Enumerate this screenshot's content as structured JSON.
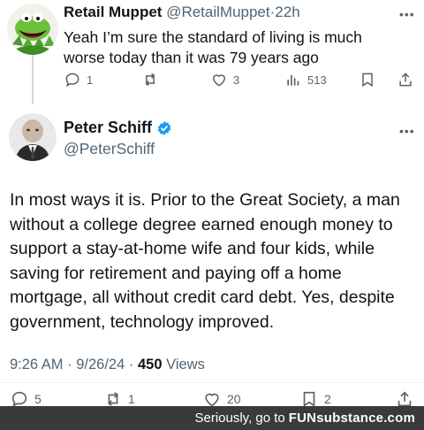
{
  "reply": {
    "name": "Retail Muppet",
    "handle": "@RetailMuppet",
    "separator": "·",
    "time": "22h",
    "text": "Yeah I’m sure the standard of living is much worse today than it was 79 years ago",
    "more": "•••",
    "actions": {
      "replies": "1",
      "retweets": "",
      "likes": "3",
      "views": "513"
    }
  },
  "tweet": {
    "name": "Peter Schiff",
    "handle": "@PeterSchiff",
    "more": "•••",
    "verified_color": "#1d9bf0",
    "text": "In most ways it is. Prior to the Great Society, a man without a college degree earned enough money to support a stay-at-home wife and four kids, while saving for retirement and paying off a home mortgage, all without credit card debt. Yes, despite government, technology improved.",
    "time": "9:26 AM",
    "separator": "·",
    "date": "9/26/24",
    "views_count": "450",
    "views_label": "Views",
    "actions": {
      "replies": "5",
      "retweets": "1",
      "likes": "20",
      "bookmarks": "2"
    }
  },
  "banner": {
    "text": "Seriously, go to",
    "logo": "FUNsubstance.com"
  },
  "colors": {
    "text": "#0f1419",
    "muted": "#536471",
    "accent": "#1d9bf0",
    "banner_bg": "#3a3a3a"
  }
}
